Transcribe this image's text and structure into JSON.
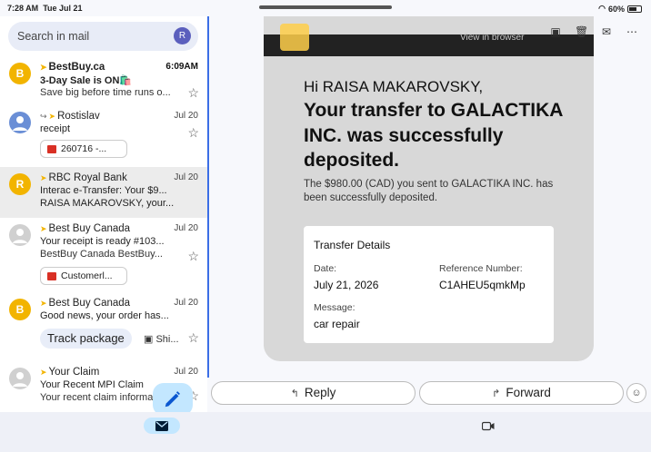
{
  "status": {
    "time": "7:28 AM",
    "date": "Tue Jul 21",
    "battery": "60%"
  },
  "search": {
    "placeholder": "Search in mail",
    "avatar_initial": "R"
  },
  "mails": [
    {
      "avatar": "B",
      "avatar_color": "#f2b400",
      "sender": "BestBuy.ca",
      "date": "6:09AM",
      "subject": "3-Day Sale is ON🛍️",
      "snippet": "Save big before time runs o..."
    },
    {
      "avatar": "",
      "avatar_color": "#6b8fd6",
      "sender": "Rostislav",
      "date": "Jul 20",
      "subject": "receipt",
      "attachment": "260716 -..."
    },
    {
      "avatar": "R",
      "avatar_color": "#f2b400",
      "sender": "RBC Royal Bank",
      "date": "Jul 20",
      "subject": "Interac e-Transfer: Your $9...",
      "snippet": "RAISA MAKAROVSKY, your..."
    },
    {
      "avatar": "",
      "avatar_color": "#c8c8c8",
      "sender": "Best Buy Canada",
      "date": "Jul 20",
      "subject": "Your receipt is ready #103...",
      "snippet": "BestBuy Canada BestBuy...",
      "attachment": "Customerl..."
    },
    {
      "avatar": "B",
      "avatar_color": "#f2b400",
      "sender": "Best Buy Canada",
      "date": "Jul 20",
      "subject": "Good news, your order has...",
      "action": "Track package",
      "action2": "Shi..."
    },
    {
      "avatar": "",
      "avatar_color": "#c8c8c8",
      "sender": "Your Claim",
      "date": "Jul 20",
      "subject": "Your Recent MPI Claim",
      "snippet": "Your recent claim informati..."
    }
  ],
  "email": {
    "header_link": "View in browser",
    "greeting": "Hi RAISA MAKAROVSKY,",
    "headline": "Your transfer to GALACTIKA INC. was successfully deposited.",
    "body": "The $980.00 (CAD) you sent to GALACTIKA INC. has been successfully deposited.",
    "details_title": "Transfer Details",
    "date_label": "Date:",
    "date_value": "July 21, 2026",
    "ref_label": "Reference Number:",
    "ref_value": "C1AHEU5qmkMp",
    "msg_label": "Message:",
    "msg_value": "car repair"
  },
  "actions": {
    "reply": "Reply",
    "forward": "Forward"
  }
}
